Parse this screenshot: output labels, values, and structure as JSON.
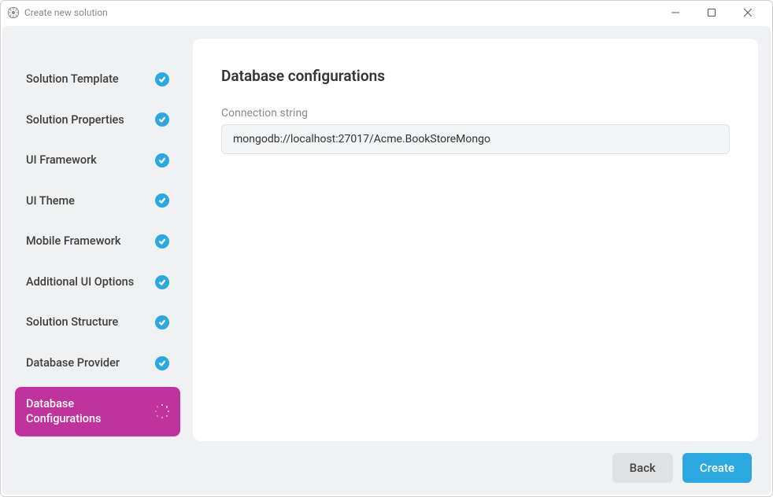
{
  "window": {
    "title": "Create new solution"
  },
  "sidebar": {
    "steps": [
      {
        "label": "Solution Template"
      },
      {
        "label": "Solution Properties"
      },
      {
        "label": "UI Framework"
      },
      {
        "label": "UI Theme"
      },
      {
        "label": "Mobile Framework"
      },
      {
        "label": "Additional UI Options"
      },
      {
        "label": "Solution Structure"
      },
      {
        "label": "Database Provider"
      },
      {
        "label": "Database Configurations"
      }
    ]
  },
  "main": {
    "title": "Database configurations",
    "connectionFieldLabel": "Connection string",
    "connectionString": "mongodb://localhost:27017/Acme.BookStoreMongo"
  },
  "footer": {
    "backLabel": "Back",
    "createLabel": "Create"
  }
}
